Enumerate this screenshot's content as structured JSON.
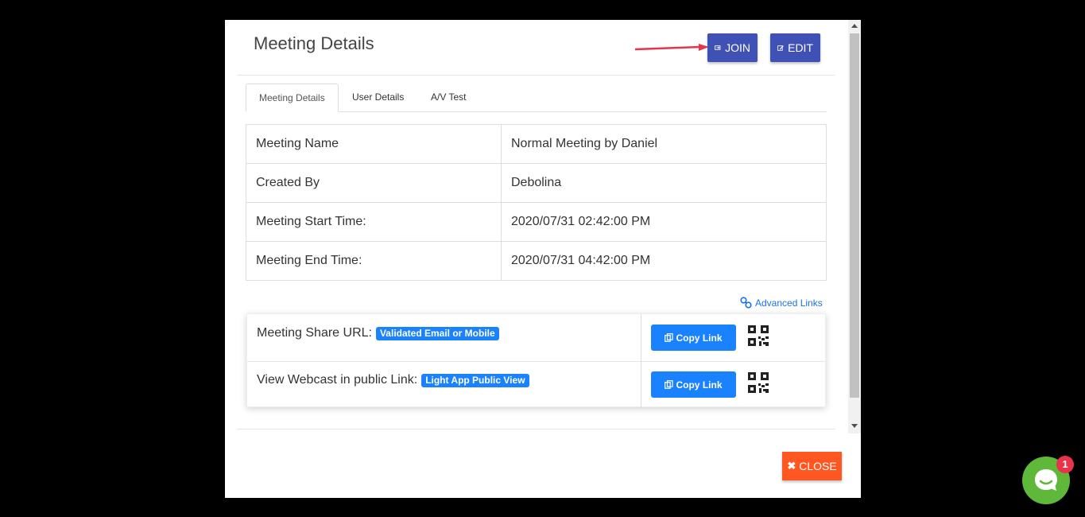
{
  "modal": {
    "title": "Meeting Details",
    "join_label": "JOIN",
    "edit_label": "EDIT",
    "close_label": "CLOSE"
  },
  "tabs": [
    {
      "label": "Meeting Details",
      "active": true
    },
    {
      "label": "User Details",
      "active": false
    },
    {
      "label": "A/V Test",
      "active": false
    }
  ],
  "details": [
    {
      "label": "Meeting Name",
      "value": "Normal Meeting by Daniel"
    },
    {
      "label": "Created By",
      "value": "Debolina"
    },
    {
      "label": "Meeting Start Time:",
      "value": "2020/07/31 02:42:00 PM"
    },
    {
      "label": "Meeting End Time:",
      "value": "2020/07/31 04:42:00 PM"
    }
  ],
  "advanced_links_label": "Advanced Links",
  "links": [
    {
      "label": "Meeting Share URL:",
      "badge": "Validated Email or Mobile",
      "button": "Copy Link"
    },
    {
      "label": "View Webcast in public Link:",
      "badge": "Light App Public View",
      "button": "Copy Link"
    }
  ],
  "chat": {
    "unread_count": "1"
  },
  "colors": {
    "primary_button": "#3f51b5",
    "link_button": "#1a82ff",
    "close_button": "#ff5722",
    "chat_bubble": "#5fb83a",
    "annotation_arrow": "#e8334a"
  }
}
